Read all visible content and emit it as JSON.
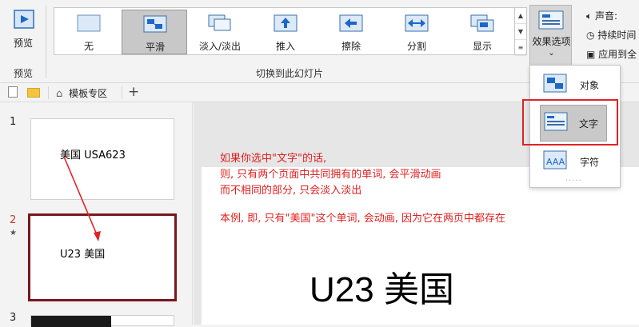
{
  "ribbon": {
    "preview_label": "预览",
    "preview_group_label": "预览",
    "transitions": [
      {
        "label": "无",
        "icon": "none-transition-icon",
        "selected": false
      },
      {
        "label": "平滑",
        "icon": "morph-transition-icon",
        "selected": true
      },
      {
        "label": "淡入/淡出",
        "icon": "fade-transition-icon",
        "selected": false
      },
      {
        "label": "推入",
        "icon": "push-transition-icon",
        "selected": false
      },
      {
        "label": "擦除",
        "icon": "wipe-transition-icon",
        "selected": false
      },
      {
        "label": "分割",
        "icon": "split-transition-icon",
        "selected": false
      },
      {
        "label": "显示",
        "icon": "reveal-transition-icon",
        "selected": false
      }
    ],
    "group_label": "切换到此幻灯片",
    "effects_label": "效果选项",
    "sound_label": "声音:",
    "duration_label": "持续时间",
    "apply_all_label": "应用到全"
  },
  "tabs": {
    "home_tab": "模板专区",
    "add_icon": "plus-icon"
  },
  "dropdown": {
    "items": [
      {
        "label": "对象",
        "icon": "object-icon",
        "selected": false
      },
      {
        "label": "文字",
        "icon": "text-icon",
        "selected": true
      },
      {
        "label": "字符",
        "icon": "character-icon",
        "selected": false
      }
    ],
    "more": "....."
  },
  "slides": {
    "items": [
      {
        "number": "1",
        "text": "美国  USA623"
      },
      {
        "number": "2",
        "text": "U23 美国"
      },
      {
        "number": "3",
        "text": ""
      }
    ],
    "star": "★"
  },
  "notes": [
    "如果你选中\"文字\"的话,",
    "则, 只有两个页面中共同拥有的单词, 会平滑动画",
    "而不相同的部分, 只会淡入淡出",
    "本例, 即, 只有\"美国\"这个单词, 会动画, 因为它在两页中都存在"
  ],
  "slide_title": "U23 美国",
  "colors": {
    "accent": "#1e66c8",
    "annotation": "#e02020",
    "selected_slide_border": "#7a1620"
  }
}
